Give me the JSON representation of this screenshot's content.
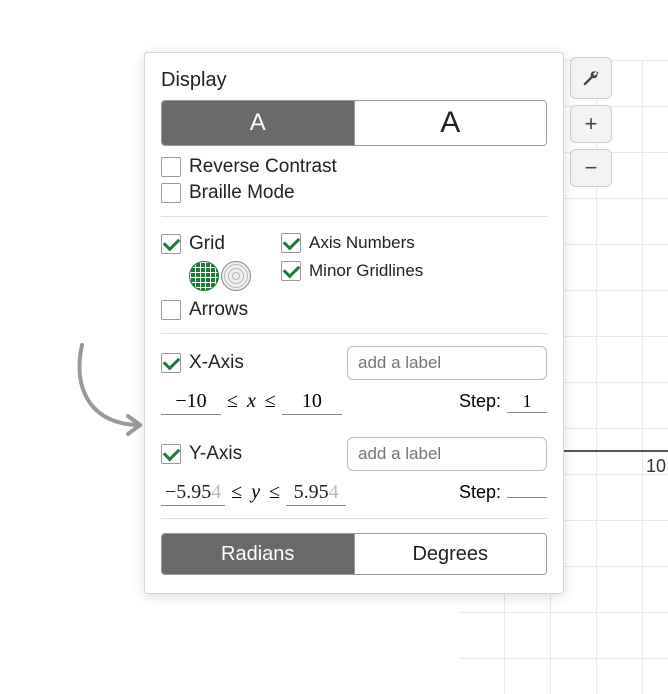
{
  "display": {
    "title": "Display",
    "font_small": "A",
    "font_large": "A",
    "reverse_contrast": {
      "label": "Reverse Contrast",
      "checked": false
    },
    "braille_mode": {
      "label": "Braille Mode",
      "checked": false
    }
  },
  "grid": {
    "label": "Grid",
    "checked": true,
    "style": "square",
    "axis_numbers": {
      "label": "Axis Numbers",
      "checked": true
    },
    "minor_gridlines": {
      "label": "Minor Gridlines",
      "checked": true
    },
    "arrows": {
      "label": "Arrows",
      "checked": false
    }
  },
  "x_axis": {
    "label": "X-Axis",
    "checked": true,
    "add_label_placeholder": "add a label",
    "min": "−10",
    "var": "x",
    "max": "10",
    "step_label": "Step:",
    "step": "1"
  },
  "y_axis": {
    "label": "Y-Axis",
    "checked": true,
    "add_label_placeholder": "add a label",
    "min_main": "−5.95",
    "min_tail": "4",
    "var": "y",
    "max_main": "5.95",
    "max_tail": "4",
    "step_label": "Step:",
    "step": ""
  },
  "angle": {
    "radians": "Radians",
    "degrees": "Degrees",
    "active": "radians"
  },
  "graph": {
    "tick_label": "10"
  },
  "tools": {
    "plus": "+",
    "minus": "−"
  }
}
